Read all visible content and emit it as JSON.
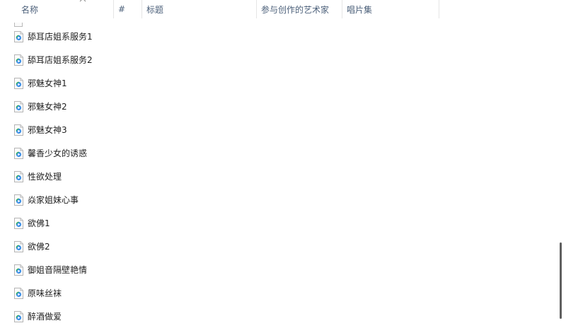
{
  "columns": {
    "name": "名称",
    "number": "#",
    "title": "标题",
    "contributing_artists": "参与创作的艺术家",
    "album": "唱片集"
  },
  "sort": {
    "column": "name",
    "direction": "ascending",
    "icon": "chevron-up-icon"
  },
  "files": [
    {
      "name": "舔耳店姐系服务1",
      "icon": "media-file-icon"
    },
    {
      "name": "舔耳店姐系服务2",
      "icon": "media-file-icon"
    },
    {
      "name": "邪魅女神1",
      "icon": "media-file-icon"
    },
    {
      "name": "邪魅女神2",
      "icon": "media-file-icon"
    },
    {
      "name": "邪魅女神3",
      "icon": "media-file-icon"
    },
    {
      "name": "馨香少女的诱惑",
      "icon": "media-file-icon"
    },
    {
      "name": "性欲处理",
      "icon": "media-file-icon"
    },
    {
      "name": "焱家姐妹心事",
      "icon": "media-file-icon"
    },
    {
      "name": "欲佛1",
      "icon": "media-file-icon"
    },
    {
      "name": "欲佛2",
      "icon": "media-file-icon"
    },
    {
      "name": "御姐音隔壁艳情",
      "icon": "media-file-icon"
    },
    {
      "name": "原味丝袜",
      "icon": "media-file-icon"
    },
    {
      "name": "醉酒做爱",
      "icon": "media-file-icon"
    }
  ],
  "scroll": {
    "position_fraction": 0.78,
    "thumb_color": "#5f5f5f"
  },
  "colors": {
    "header_text": "#4c607a",
    "divider": "#e5e5e5",
    "media_play": "#2bb24c",
    "media_accent": "#3a8ee6"
  }
}
